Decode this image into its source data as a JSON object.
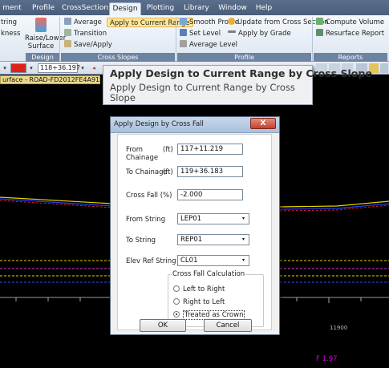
{
  "tabs": [
    "ment",
    "Profile",
    "CrossSection",
    "Design",
    "Plotting",
    "Library",
    "Window",
    "Help"
  ],
  "active_tab": "Design",
  "ribbon": {
    "cut_items": [
      "tring",
      "kness"
    ],
    "raise_lower": "Raise/Lower Surface",
    "average": "Average",
    "transition": "Transition",
    "save_apply": "Save/Apply",
    "apply_current": "Apply to Current Range",
    "smooth_profile": "Smooth Profile",
    "set_level": "Set Level",
    "average_level": "Average Level",
    "update_from_cs": "Update from Cross Section",
    "apply_by_grade": "Apply by Grade",
    "compute_volume": "Compute Volume",
    "resurface_report": "Resurface Report",
    "groups": [
      "Design",
      "Cross Slopes",
      "Profile",
      "Reports"
    ]
  },
  "toolbar": {
    "chainage": "118+36.197",
    "arrow_glyph": "▾",
    "nav_glyph": "◂"
  },
  "doc_title": "urface - ROAD-FD2012FE4A915443",
  "tooltip": {
    "title": "Apply Design to Current Range by Cross Slope",
    "body": "Apply Design to Current Range by Cross Slope"
  },
  "dialog": {
    "title": "Apply Design by Cross Fall",
    "close_glyph": "X",
    "from_chainage_label": "From Chainage",
    "from_unit": "(ft)",
    "from_chainage": "117+11.219",
    "to_chainage_label": "To Chainage",
    "to_unit": "(ft)",
    "to_chainage": "119+36.183",
    "cross_fall_label": "Cross Fall (%)",
    "cross_fall": "-2.000",
    "from_string_label": "From String",
    "from_string": "LEP01",
    "to_string_label": "To String",
    "to_string": "REP01",
    "elev_ref_label": "Elev Ref String",
    "elev_ref": "CL01",
    "calc_group": "Cross Fall Calculation",
    "options": [
      "Left to Right",
      "Right to Left",
      "Treated as Crown"
    ],
    "selected_option": 2,
    "ok": "OK",
    "cancel": "Cancel"
  },
  "drawing": {
    "station_label": "11900",
    "status": "F 1.97"
  },
  "colors": {
    "ribbon_tab": "#4a5e7a",
    "highlight": "#fde69a",
    "drawing_bg": "#000000",
    "status_text": "#d000d0"
  }
}
